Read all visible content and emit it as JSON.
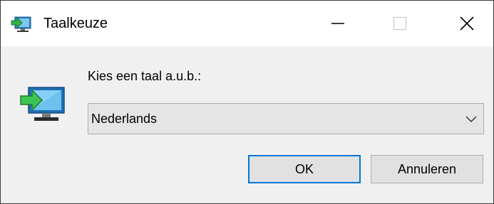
{
  "window": {
    "title": "Taalkeuze",
    "icon": "setup-monitor-arrow-icon",
    "controls": {
      "minimize": "minimize-icon",
      "maximize": "maximize-icon",
      "close": "close-icon"
    }
  },
  "dialog": {
    "prompt": "Kies een taal a.u.b.:",
    "icon": "setup-monitor-arrow-icon",
    "language_select": {
      "selected": "Nederlands"
    },
    "ok_label": "OK",
    "cancel_label": "Annuleren"
  },
  "colors": {
    "accent": "#0078d7",
    "titlebar": "#ffffff",
    "client": "#f0f0f0"
  }
}
